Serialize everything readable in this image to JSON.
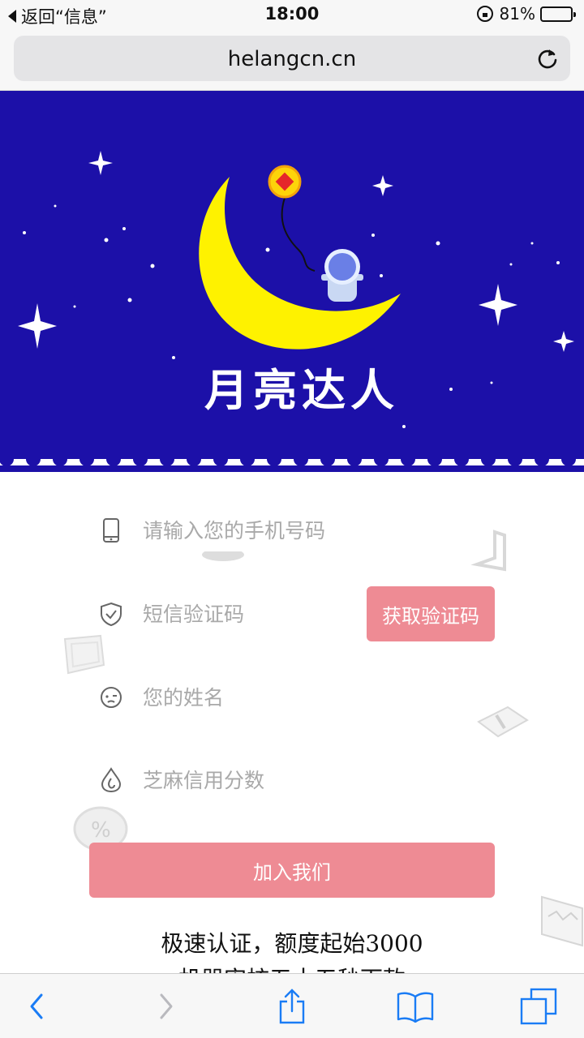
{
  "status_bar": {
    "back_label": "返回“信息”",
    "time": "18:00",
    "battery_text": "81%",
    "battery_level": 0.81,
    "icons": [
      "back-triangle-icon",
      "rotation-lock-icon",
      "battery-icon"
    ]
  },
  "browser": {
    "url": "helangcn.cn",
    "reload_icon": "reload-icon"
  },
  "banner": {
    "title": "月亮达人",
    "background": "#1c10a8",
    "moon_color": "#fef200",
    "art": [
      "moon",
      "coin-balloon",
      "astronaut",
      "stars"
    ]
  },
  "form": {
    "phone": {
      "placeholder": "请输入您的手机号码",
      "icon": "phone-icon"
    },
    "sms_code": {
      "placeholder": "短信验证码",
      "icon": "shield-check-icon"
    },
    "get_code_label": "获取验证码",
    "name": {
      "placeholder": "您的姓名",
      "icon": "face-icon"
    },
    "sesame_score": {
      "placeholder": "芝麻信用分数",
      "icon": "drop-icon"
    },
    "join_label": "加入我们",
    "accent": "#ee8b94"
  },
  "promo": {
    "line1": "极速认证，额度起始3000",
    "line2": "机器审核五十五秒下款"
  },
  "toolbar": {
    "items": [
      "back-icon",
      "forward-icon",
      "share-icon",
      "bookmarks-icon",
      "tabs-icon"
    ],
    "tint": "#1a7cf5"
  }
}
